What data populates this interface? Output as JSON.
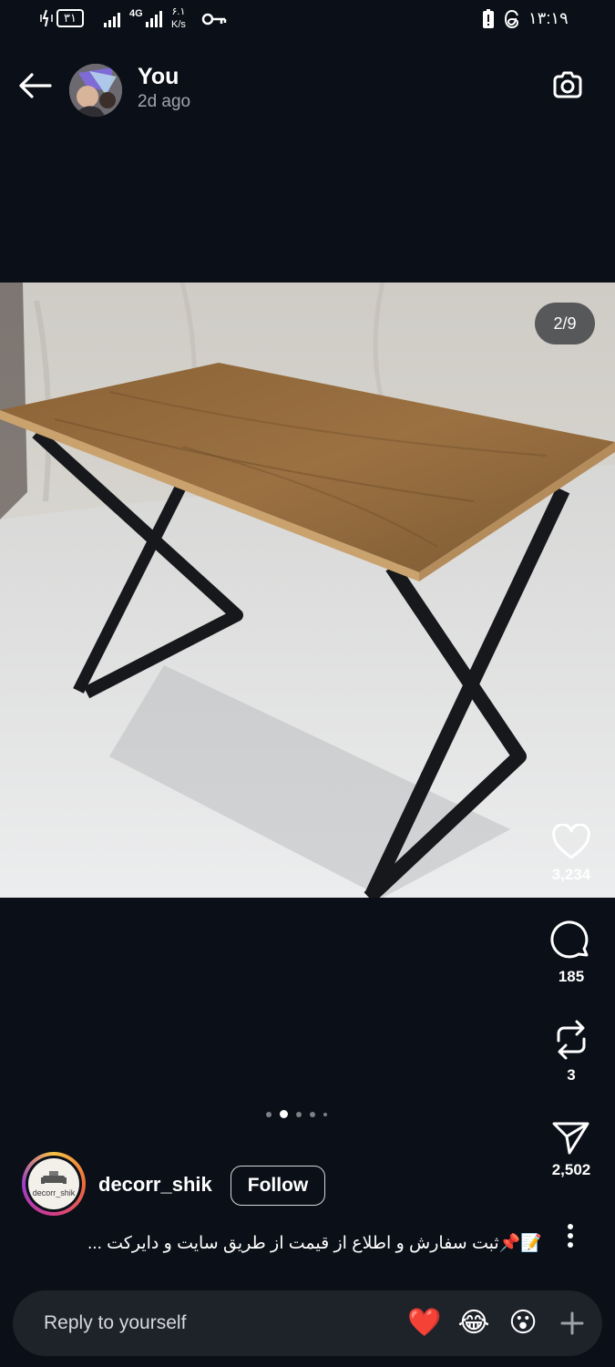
{
  "status_bar": {
    "battery_indicator": "۳۱",
    "network_type": "4G",
    "speed_value": "۶.۱",
    "speed_unit": "K/s",
    "time": "۱۳:۱۹",
    "icons": [
      "vibrate-icon",
      "battery-icon",
      "signal-icon",
      "signal-4g-icon",
      "vpn-key-icon",
      "alert-icon",
      "threads-icon"
    ]
  },
  "header": {
    "user_name": "You",
    "timestamp": "2d ago",
    "back_icon": "arrow-left-icon",
    "camera_icon": "camera-icon"
  },
  "photo": {
    "counter": "2/9",
    "description_icon": "product-photo"
  },
  "actions": {
    "like": {
      "icon": "heart-icon",
      "count": "3,234"
    },
    "comment": {
      "icon": "comment-bubble-icon",
      "count": "185"
    },
    "repost": {
      "icon": "repost-icon",
      "count": "3"
    },
    "share": {
      "icon": "send-icon",
      "count": "2,502"
    }
  },
  "carousel": {
    "total_dots": 5,
    "active_index": 1
  },
  "author": {
    "username": "decorr_shik",
    "avatar_text": "decorr_shik",
    "follow_label": "Follow"
  },
  "caption": {
    "text": "📝📌ثبت سفارش و اطلاع از قیمت از طریق سایت و دایرکت ..."
  },
  "reply": {
    "placeholder": "Reply to yourself",
    "emojis": [
      "❤️",
      "😂",
      "😮"
    ],
    "plus_icon": "plus-icon"
  },
  "colors": {
    "background": "#0b0f17",
    "reply_bar": "#1e2229",
    "muted_text": "#a0a4ad",
    "heart_red": "#e0303a"
  }
}
